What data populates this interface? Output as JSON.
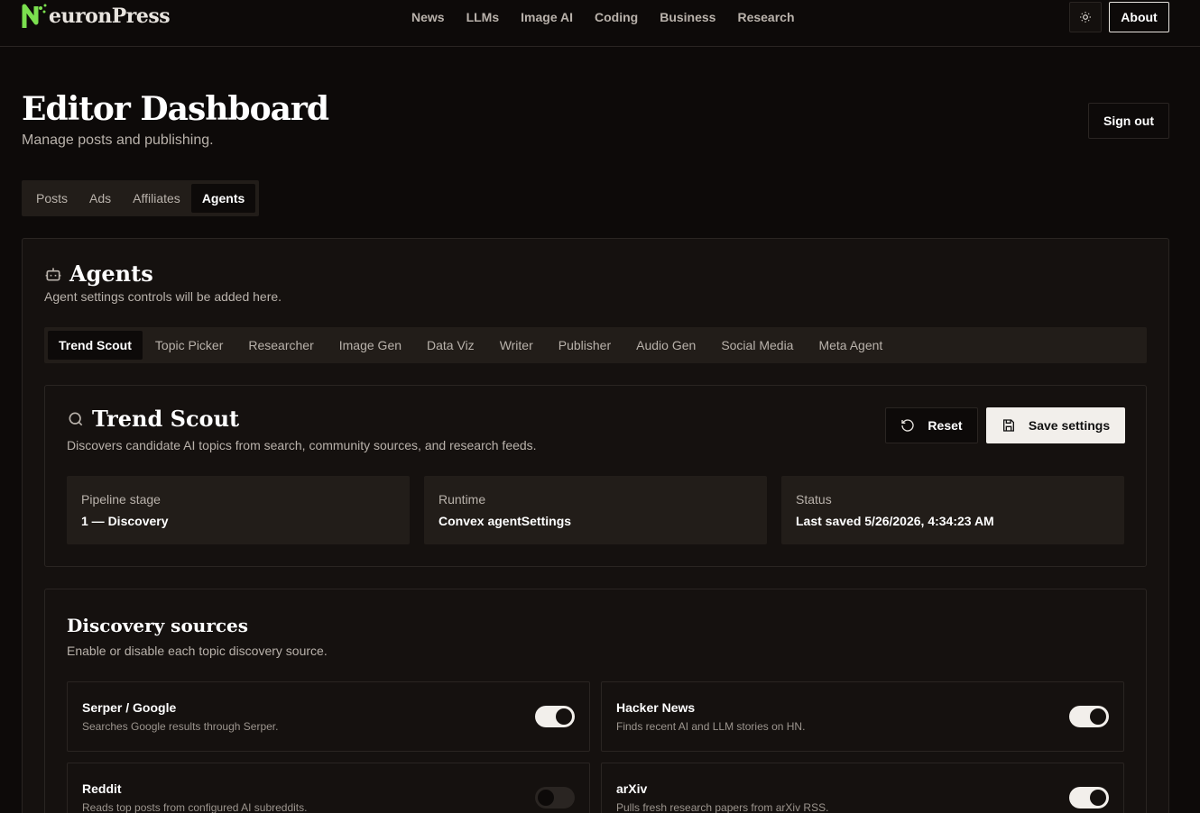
{
  "brand": {
    "name_prefix": "N",
    "name_rest": "euronPress"
  },
  "nav": [
    "News",
    "LLMs",
    "Image AI",
    "Coding",
    "Business",
    "Research"
  ],
  "header": {
    "about_label": "About",
    "title": "Editor Dashboard",
    "subtitle": "Manage posts and publishing.",
    "signout_label": "Sign out"
  },
  "main_tabs": [
    {
      "label": "Posts",
      "active": false
    },
    {
      "label": "Ads",
      "active": false
    },
    {
      "label": "Affiliates",
      "active": false
    },
    {
      "label": "Agents",
      "active": true
    }
  ],
  "agents": {
    "title": "Agents",
    "description": "Agent settings controls will be added here.",
    "tabs": [
      "Trend Scout",
      "Topic Picker",
      "Researcher",
      "Image Gen",
      "Data Viz",
      "Writer",
      "Publisher",
      "Audio Gen",
      "Social Media",
      "Meta Agent"
    ]
  },
  "trend_scout": {
    "title": "Trend Scout",
    "description": "Discovers candidate AI topics from search, community sources, and research feeds.",
    "reset_label": "Reset",
    "save_label": "Save settings",
    "stats": [
      {
        "label": "Pipeline stage",
        "value": "1 — Discovery"
      },
      {
        "label": "Runtime",
        "value": "Convex agentSettings"
      },
      {
        "label": "Status",
        "value": "Last saved 5/26/2026, 4:34:23 AM"
      }
    ]
  },
  "discovery": {
    "title": "Discovery sources",
    "description": "Enable or disable each topic discovery source.",
    "sources": [
      {
        "name": "Serper / Google",
        "description": "Searches Google results through Serper.",
        "enabled": true
      },
      {
        "name": "Hacker News",
        "description": "Finds recent AI and LLM stories on HN.",
        "enabled": true
      },
      {
        "name": "Reddit",
        "description": "Reads top posts from configured AI subreddits.",
        "enabled": false
      },
      {
        "name": "arXiv",
        "description": "Pulls fresh research papers from arXiv RSS.",
        "enabled": true
      }
    ]
  },
  "colors": {
    "brand_green": "#7be04f",
    "background": "#0d0a09"
  }
}
